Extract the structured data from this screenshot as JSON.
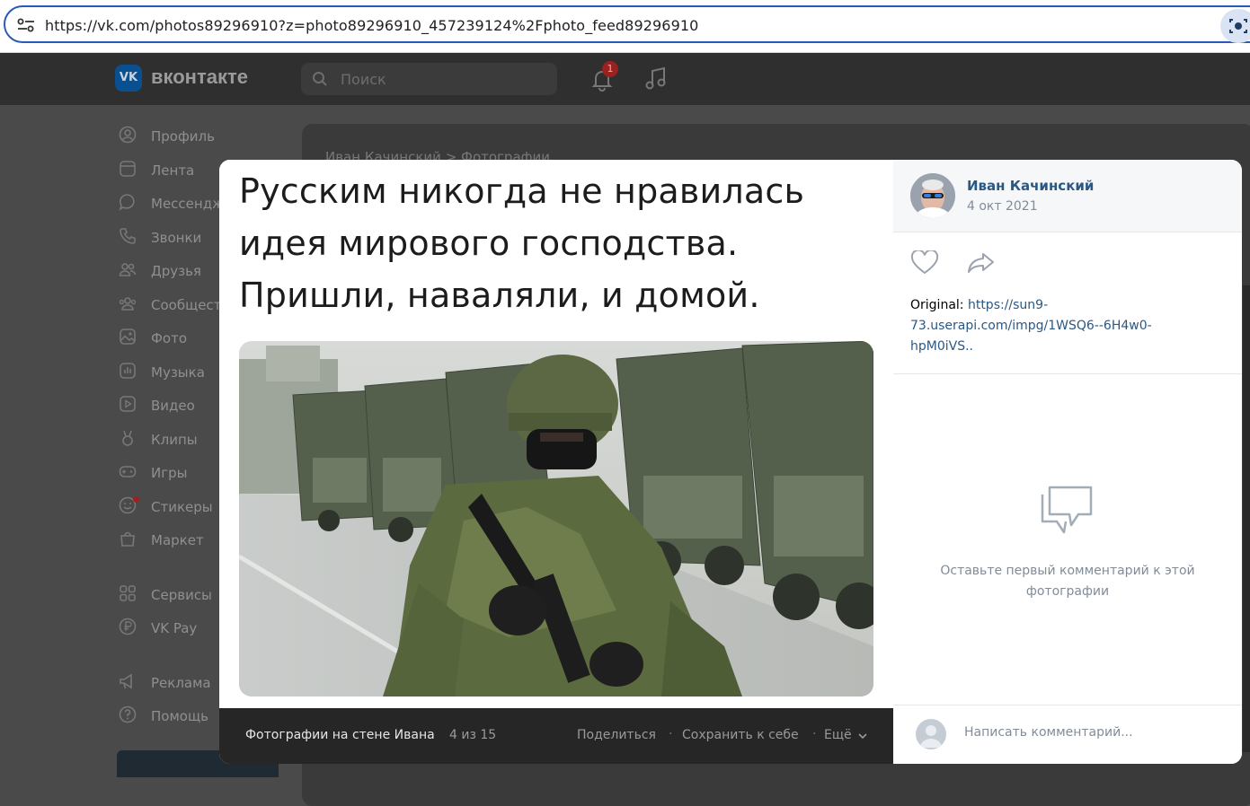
{
  "browser": {
    "url": "https://vk.com/photos89296910?z=photo89296910_457239124%2Fphoto_feed89296910",
    "site_info_icon": "tune-icon",
    "lens_icon": "camera-search-icon"
  },
  "vk_header": {
    "logo_text": "VK",
    "brand": "вконтакте",
    "search_placeholder": "Поиск",
    "notifications_count": "1"
  },
  "sidebar": {
    "items": [
      {
        "label": "Профиль",
        "icon": "profile-icon"
      },
      {
        "label": "Лента",
        "icon": "feed-icon"
      },
      {
        "label": "Мессенджер",
        "icon": "messenger-icon"
      },
      {
        "label": "Звонки",
        "icon": "phone-icon"
      },
      {
        "label": "Друзья",
        "icon": "friends-icon"
      },
      {
        "label": "Сообщества",
        "icon": "communities-icon"
      },
      {
        "label": "Фото",
        "icon": "photo-icon"
      },
      {
        "label": "Музыка",
        "icon": "music-icon"
      },
      {
        "label": "Видео",
        "icon": "video-icon"
      },
      {
        "label": "Клипы",
        "icon": "clips-icon"
      },
      {
        "label": "Игры",
        "icon": "games-icon"
      },
      {
        "label": "Стикеры",
        "icon": "stickers-icon"
      },
      {
        "label": "Маркет",
        "icon": "market-icon"
      },
      {
        "label": "Сервисы",
        "icon": "services-icon"
      },
      {
        "label": "VK Pay",
        "icon": "vkpay-icon"
      },
      {
        "label": "Реклама",
        "icon": "ads-icon"
      },
      {
        "label": "Помощь",
        "icon": "help-icon"
      }
    ]
  },
  "background_breadcrumb": {
    "owner": "Иван Качинский",
    "separator": ">",
    "section": "Фотографии"
  },
  "viewer": {
    "caption_lines": [
      "Русским никогда не нравилась",
      "идея мирового господства.",
      "Пришли, наваляли, и домой."
    ],
    "footer": {
      "album": "Фотографии на стене Ивана",
      "count": "4 из 15",
      "share": "Поделиться",
      "dot": "·",
      "save": "Сохранить к себе",
      "more": "Ещё"
    },
    "author": {
      "name": "Иван Качинский",
      "date": "4 окт 2021"
    },
    "description": {
      "label": "Original:",
      "link_line1": "https://sun9-",
      "link_line2": "73.userapi.com/impg/1WSQ6--6H4w0-",
      "link_line3": "hpM0iVS.."
    },
    "empty_comments": "Оставьте первый комментарий к этой фотографии",
    "comment_placeholder": "Написать комментарий..."
  },
  "colors": {
    "link": "#2a5885",
    "muted": "#818c99",
    "address_bar_border": "#2b5bb8",
    "footer_bg": "#262626"
  }
}
